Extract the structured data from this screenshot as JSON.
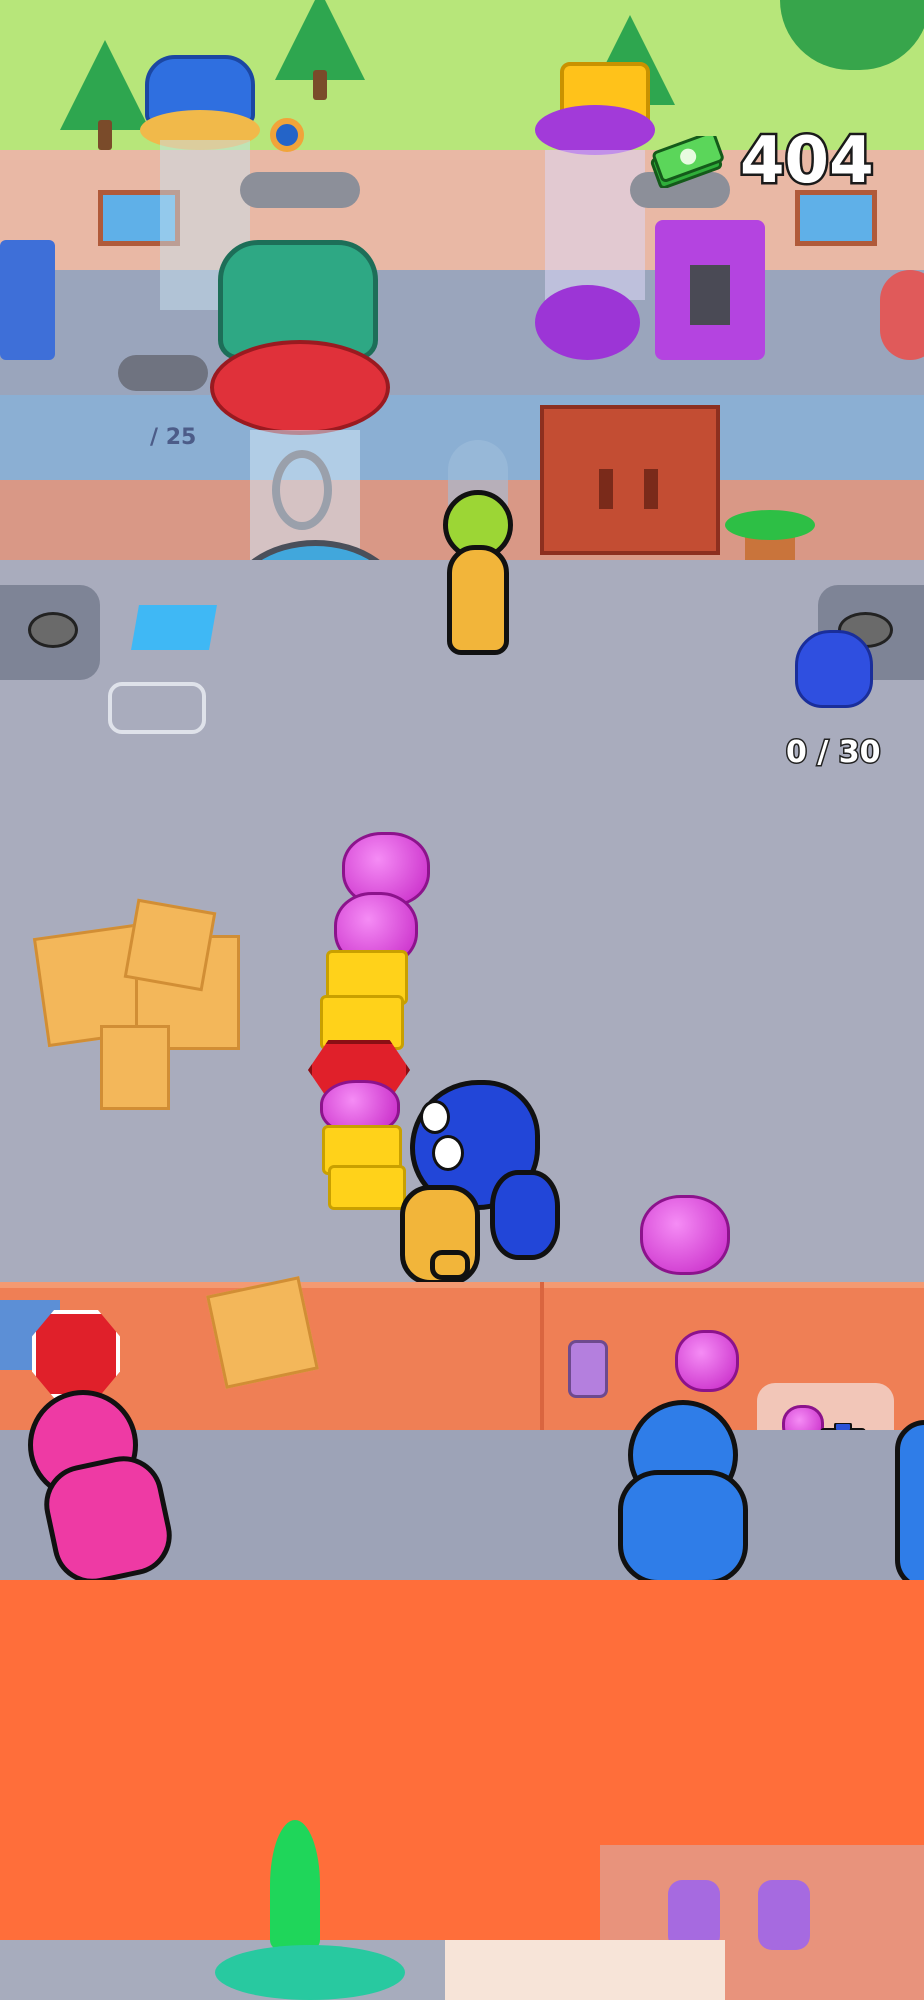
{
  "hud": {
    "money_value": "404",
    "cash_icon": "cash-stack-icon"
  },
  "stations": {
    "right_station_counter": "0 / 30",
    "left_station_counter": "/ 25"
  },
  "colors": {
    "floor": "#a9acbd",
    "wall": "#e9b8a5",
    "counter": "#ef7f55",
    "accent_orange": "#ff6e3a",
    "grass": "#b7e67a",
    "door": "#c34d33"
  },
  "icons": [
    "cash-stack-icon",
    "trash-can-icon",
    "jelly-icon",
    "slime-monster-icon"
  ]
}
